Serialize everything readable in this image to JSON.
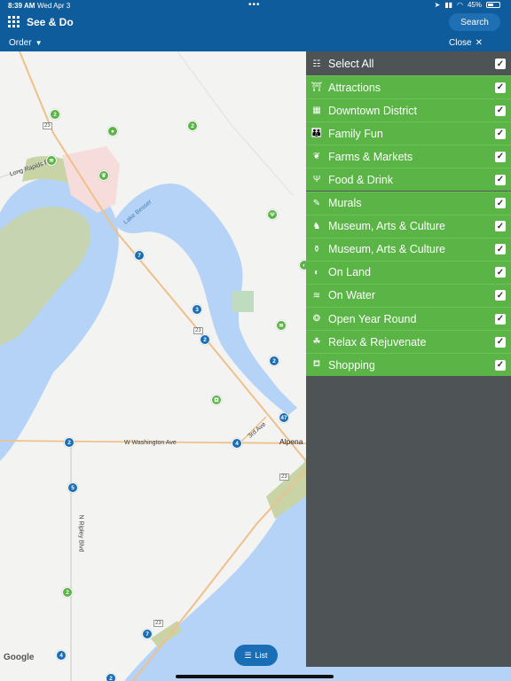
{
  "status": {
    "time": "8:39 AM",
    "date": "Wed Apr 3",
    "battery": "45%"
  },
  "header": {
    "title": "See & Do",
    "search_label": "Search"
  },
  "subbar": {
    "order_label": "Order",
    "close_label": "Close"
  },
  "map": {
    "labels": {
      "road_long_rapids": "Long Rapids Rd",
      "lake": "Lake Besser",
      "washington": "W Washington Ave",
      "third_ave": "3rd Ave",
      "alpena": "Alpena",
      "ripley": "N Ripley Blvd",
      "route_23a": "23",
      "route_23b": "23",
      "route_23c": "23",
      "route_23d": "23"
    },
    "pins": [
      "2",
      "2",
      "7",
      "3",
      "2",
      "2",
      "47",
      "4",
      "2",
      "5",
      "2",
      "7",
      "4",
      "2"
    ],
    "google_label": "Google",
    "list_button": "List"
  },
  "panel": {
    "select_all": "Select All",
    "items": [
      {
        "label": "Attractions",
        "icon": "⛩"
      },
      {
        "label": "Downtown District",
        "icon": "▦"
      },
      {
        "label": "Family Fun",
        "icon": "👪"
      },
      {
        "label": "Farms & Markets",
        "icon": "❦"
      },
      {
        "label": "Food & Drink",
        "icon": "Ψ"
      },
      {
        "label": "Murals",
        "icon": "✎"
      },
      {
        "label": "Museum, Arts & Culture",
        "icon": "♞"
      },
      {
        "label": "Museum, Arts & Culture",
        "icon": "⚱"
      },
      {
        "label": "On Land",
        "icon": "◐"
      },
      {
        "label": "On Water",
        "icon": "≋"
      },
      {
        "label": "Open Year Round",
        "icon": "❂"
      },
      {
        "label": "Relax & Rejuvenate",
        "icon": "☘"
      },
      {
        "label": "Shopping",
        "icon": "⛾"
      }
    ],
    "checkmark": "✓"
  },
  "colors": {
    "header": "#0f5c9c",
    "panel": "#4e5455",
    "category_green": "#5ab446",
    "water": "#b5d3f7",
    "park": "#c5d2a0"
  }
}
